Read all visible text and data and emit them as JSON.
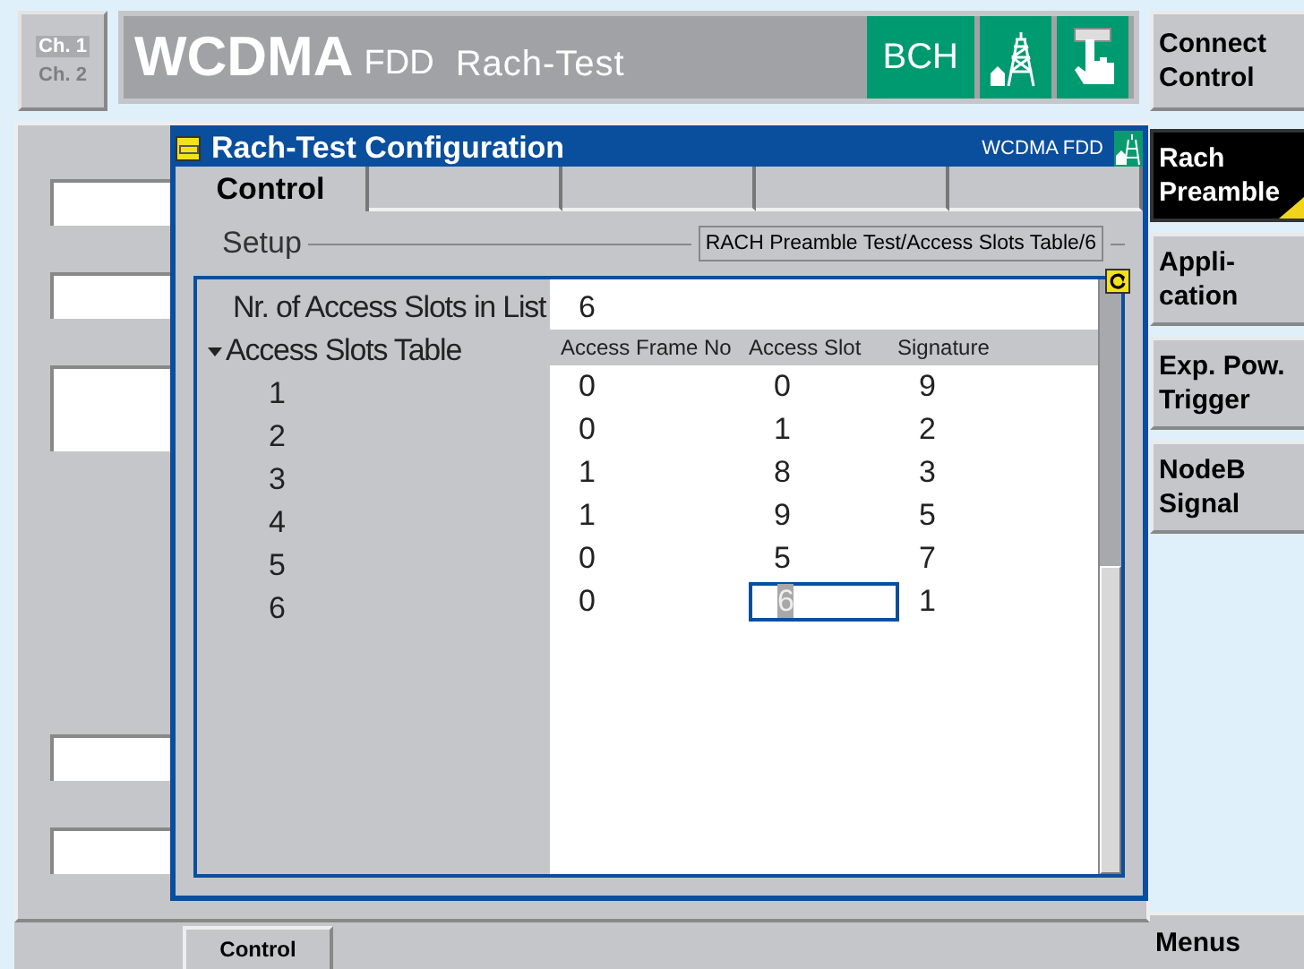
{
  "channels": [
    {
      "label": "Ch. 1",
      "selected": true
    },
    {
      "label": "Ch. 2",
      "selected": false
    }
  ],
  "header": {
    "title": "WCDMA",
    "standard": "FDD",
    "application": "Rach-Test",
    "badge": "BCH"
  },
  "connect_softkey": {
    "label": "Connect Control"
  },
  "softkeys": [
    {
      "label": "Rach Preamble",
      "selected": true
    },
    {
      "label": "Appli- cation",
      "selected": false
    },
    {
      "label": "Exp. Pow. Trigger",
      "selected": false
    },
    {
      "label": "NodeB Signal",
      "selected": false
    }
  ],
  "menus": "Menus",
  "bottom_tab": "Control",
  "dialog": {
    "title": "Rach-Test Configuration",
    "mode": "WCDMA FDD",
    "tabs": [
      {
        "label": "Control",
        "selected": true
      }
    ],
    "group": {
      "legend": "Setup",
      "path": "RACH Preamble Test/Access Slots Table/6"
    },
    "count": {
      "label": "Nr. of Access Slots in List",
      "value": "6"
    },
    "table": {
      "label": "Access Slots Table",
      "expanded": true,
      "columns": [
        "Access Frame No",
        "Access Slot",
        "Signature"
      ],
      "rows": [
        {
          "index": "1",
          "cells": [
            {
              "value": "0",
              "selected": false
            },
            {
              "value": "0",
              "selected": false
            },
            {
              "value": "9",
              "selected": false
            }
          ]
        },
        {
          "index": "2",
          "cells": [
            {
              "value": "0",
              "selected": false
            },
            {
              "value": "1",
              "selected": false
            },
            {
              "value": "2",
              "selected": false
            }
          ]
        },
        {
          "index": "3",
          "cells": [
            {
              "value": "1",
              "selected": false
            },
            {
              "value": "8",
              "selected": false
            },
            {
              "value": "3",
              "selected": false
            }
          ]
        },
        {
          "index": "4",
          "cells": [
            {
              "value": "1",
              "selected": false
            },
            {
              "value": "9",
              "selected": false
            },
            {
              "value": "5",
              "selected": false
            }
          ]
        },
        {
          "index": "5",
          "cells": [
            {
              "value": "0",
              "selected": false
            },
            {
              "value": "5",
              "selected": false
            },
            {
              "value": "7",
              "selected": false
            }
          ]
        },
        {
          "index": "6",
          "cells": [
            {
              "value": "0",
              "selected": false
            },
            {
              "value": "6",
              "selected": true
            },
            {
              "value": "1",
              "selected": false
            }
          ]
        }
      ]
    }
  }
}
